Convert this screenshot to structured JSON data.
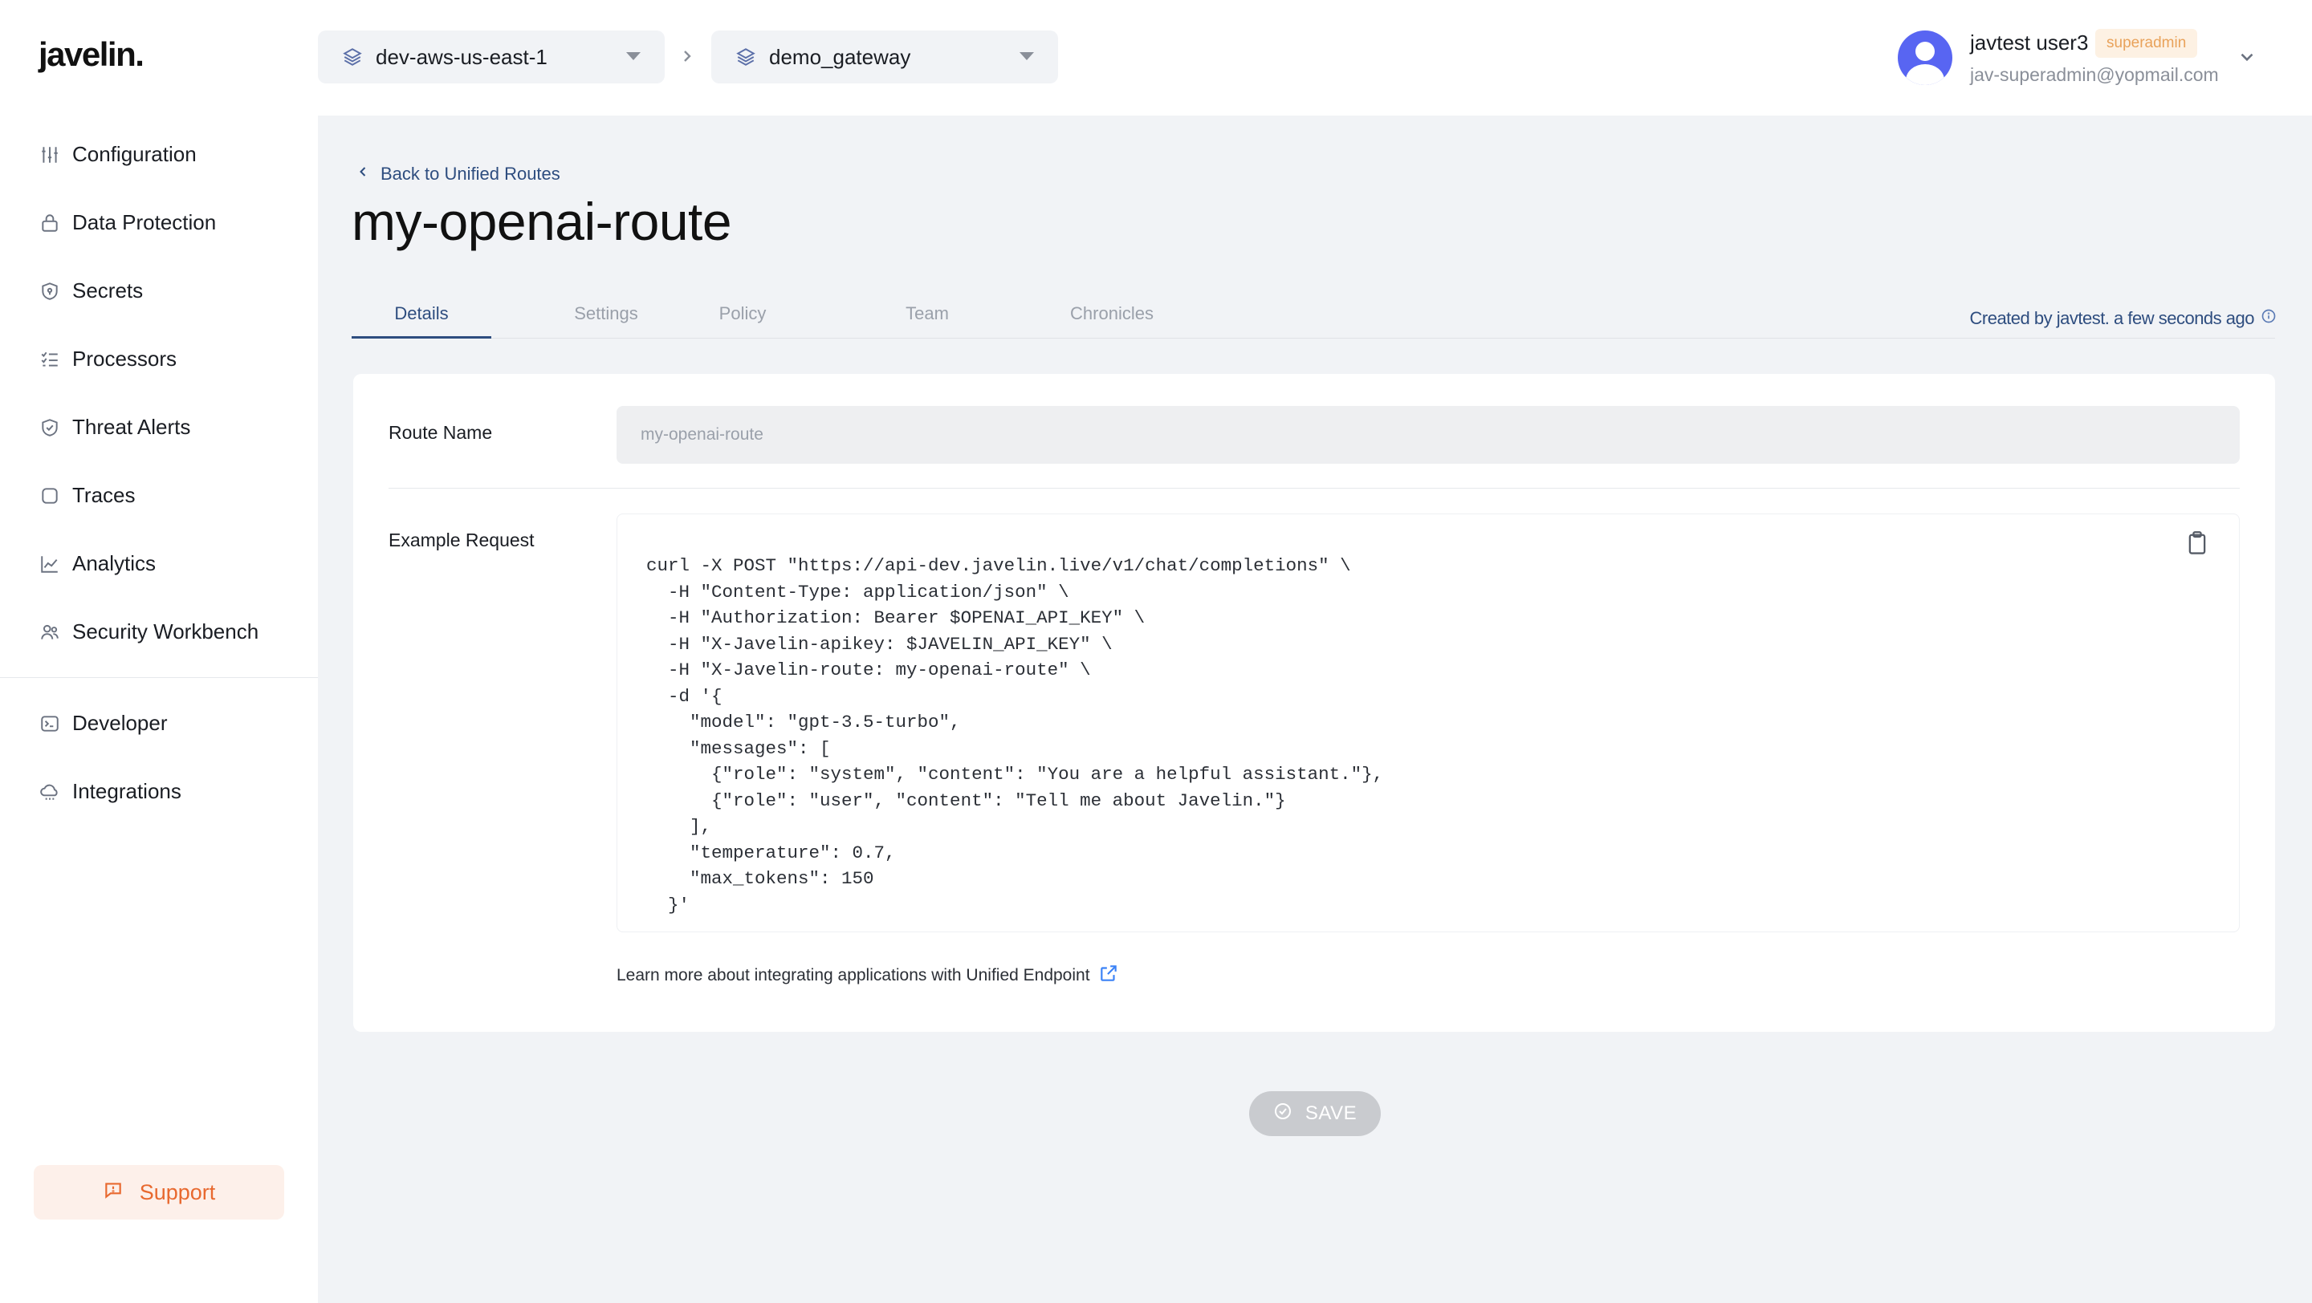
{
  "app": {
    "logo": "javelin."
  },
  "sidebar": {
    "items": [
      {
        "label": "Configuration",
        "icon": "sliders-icon"
      },
      {
        "label": "Data Protection",
        "icon": "lock-icon"
      },
      {
        "label": "Secrets",
        "icon": "shield-key-icon"
      },
      {
        "label": "Processors",
        "icon": "list-check-icon"
      },
      {
        "label": "Threat Alerts",
        "icon": "shield-check-icon"
      },
      {
        "label": "Traces",
        "icon": "square-icon"
      },
      {
        "label": "Analytics",
        "icon": "line-chart-icon"
      },
      {
        "label": "Security Workbench",
        "icon": "users-icon"
      }
    ],
    "secondary_items": [
      {
        "label": "Developer",
        "icon": "terminal-icon"
      },
      {
        "label": "Integrations",
        "icon": "cloud-icon"
      }
    ],
    "support_label": "Support"
  },
  "topbar": {
    "environment": "dev-aws-us-east-1",
    "gateway": "demo_gateway",
    "user": {
      "name": "javtest user3",
      "role": "superadmin",
      "email": "jav-superadmin@yopmail.com"
    }
  },
  "page": {
    "back_label": "Back to Unified Routes",
    "title": "my-openai-route",
    "tabs": [
      "Details",
      "Settings",
      "Policy",
      "Team",
      "Chronicles"
    ],
    "active_tab": "Details",
    "created_note": "Created by javtest. a few seconds ago"
  },
  "details": {
    "route_name_label": "Route Name",
    "route_name_value": "my-openai-route",
    "example_request_label": "Example Request",
    "example_request_code": "curl -X POST \"https://api-dev.javelin.live/v1/chat/completions\" \\\n  -H \"Content-Type: application/json\" \\\n  -H \"Authorization: Bearer $OPENAI_API_KEY\" \\\n  -H \"X-Javelin-apikey: $JAVELIN_API_KEY\" \\\n  -H \"X-Javelin-route: my-openai-route\" \\\n  -d '{\n    \"model\": \"gpt-3.5-turbo\",\n    \"messages\": [\n      {\"role\": \"system\", \"content\": \"You are a helpful assistant.\"},\n      {\"role\": \"user\", \"content\": \"Tell me about Javelin.\"}\n    ],\n    \"temperature\": 0.7,\n    \"max_tokens\": 150\n  }'",
    "learn_more": "Learn more about integrating applications with Unified Endpoint"
  },
  "actions": {
    "save_label": "SAVE"
  },
  "colors": {
    "accent": "#2e4d7f",
    "support": "#e8692f",
    "avatar": "#5865f2",
    "badge_text": "#e9a25a",
    "save_disabled": "#c9cbcf"
  }
}
